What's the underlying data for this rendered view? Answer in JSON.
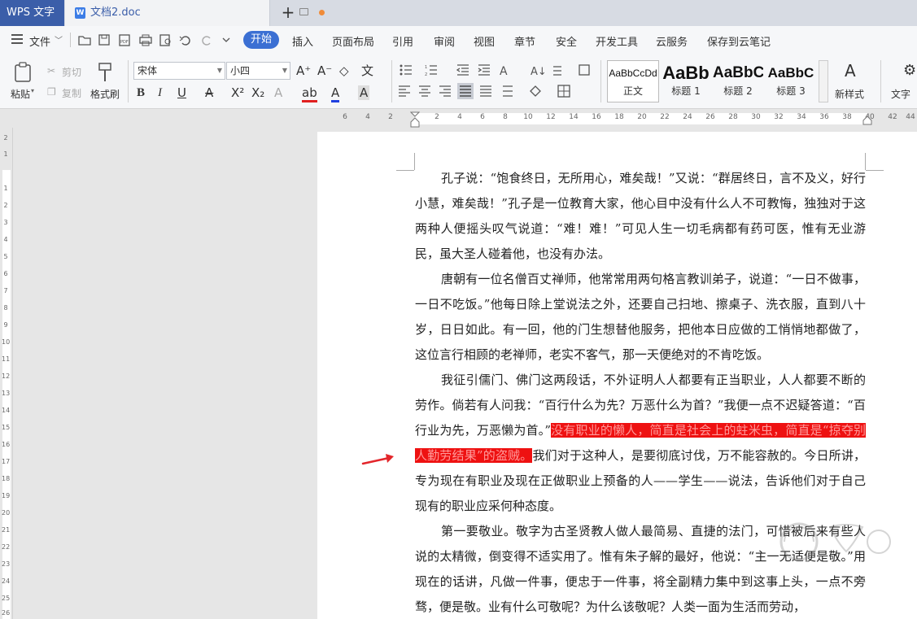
{
  "titlebar": {
    "app_name": "WPS 文字",
    "doc_name": "文档2.doc",
    "new_tab": "+"
  },
  "menubar": {
    "file": "文件",
    "active_tab": "开始",
    "tabs": [
      "插入",
      "页面布局",
      "引用",
      "审阅",
      "视图",
      "章节",
      "安全",
      "开发工具",
      "云服务",
      "保存到云笔记"
    ]
  },
  "ribbon": {
    "paste": "粘贴",
    "cut": "剪切",
    "copy": "复制",
    "format_painter": "格式刷",
    "font_name": "宋体",
    "font_size": "小四",
    "styles": [
      {
        "sample": "AaBbCcDd",
        "label": "正文"
      },
      {
        "sample": "AaBb",
        "label": "标题 1"
      },
      {
        "sample": "AaBbC",
        "label": "标题 2"
      },
      {
        "sample": "AaBbC",
        "label": "标题 3"
      }
    ],
    "new_style": "新样式",
    "text_tools": "文字"
  },
  "hruler": {
    "left_numbers": [
      "6",
      "4",
      "2"
    ],
    "numbers": [
      "2",
      "4",
      "6",
      "8",
      "10",
      "12",
      "14",
      "16",
      "18",
      "20",
      "22",
      "24",
      "26",
      "28",
      "30",
      "32",
      "34",
      "36",
      "38",
      "40",
      "42",
      "44"
    ]
  },
  "vruler": {
    "top_numbers": [
      "2",
      "1"
    ],
    "numbers": [
      "1",
      "2",
      "3",
      "4",
      "5",
      "6",
      "7",
      "8",
      "9",
      "10",
      "11",
      "12",
      "13",
      "14",
      "15",
      "16",
      "17",
      "18",
      "19",
      "20",
      "21",
      "22",
      "23",
      "24",
      "25",
      "26"
    ]
  },
  "document": {
    "p1": "孔子说：“饱食终日，无所用心，难矣哉！”又说：“群居终日，言不及义，好行小慧，难矣哉！”孔子是一位教育大家，他心目中没有什么人不可教悔，独独对于这两种人便摇头叹气说道：“难！难！”可见人生一切毛病都有药可医，惟有无业游民，虽大圣人碰着他，也没有办法。",
    "p2": "唐朝有一位名僧百丈禅师，他常常用两句格言教训弟子，说道：“一日不做事，一日不吃饭。”他每日除上堂说法之外，还要自己扫地、擦桌子、洗衣服，直到八十岁，日日如此。有一回，他的门生想替他服务，把他本日应做的工悄悄地都做了，这位言行相顾的老禅师，老实不客气，那一天便绝对的不肯吃饭。",
    "p3_before": "我征引儒门、佛门这两段话，不外证明人人都要有正当职业，人人都要不断的劳作。倘若有人问我：“百行什么为先？万恶什么为首？”我便一点不迟疑答道：“百行业为先，万恶懒为首。”",
    "p3_highlight": "没有职业的懒人，简直是社会上的蛀米虫，简直是“掠夺别人勤劳结果”的盗贼。",
    "p3_after": "我们对于这种人，是要彻底讨伐，万不能容赦的。今日所讲，专为现在有职业及现在正做职业上预备的人——学生——说法，告诉他们对于自己现有的职业应采何种态度。",
    "p4": "第一要敬业。敬字为古圣贤教人做人最简易、直捷的法门，可惜被后来有些人说的太精微，倒变得不适实用了。惟有朱子解的最好，他说：“主一无适便是敬。”用现在的话讲，凡做一件事，便忠于一件事，将全副精力集中到这事上头，一点不旁骛，便是敬。业有什么可敬呢？为什么该敬呢？人类一面为生活而劳动，"
  },
  "colors": {
    "accent": "#3b6fd3",
    "app_tab": "#3b5ea9",
    "highlight": "#ee1111",
    "arrow": "#e3262b"
  }
}
